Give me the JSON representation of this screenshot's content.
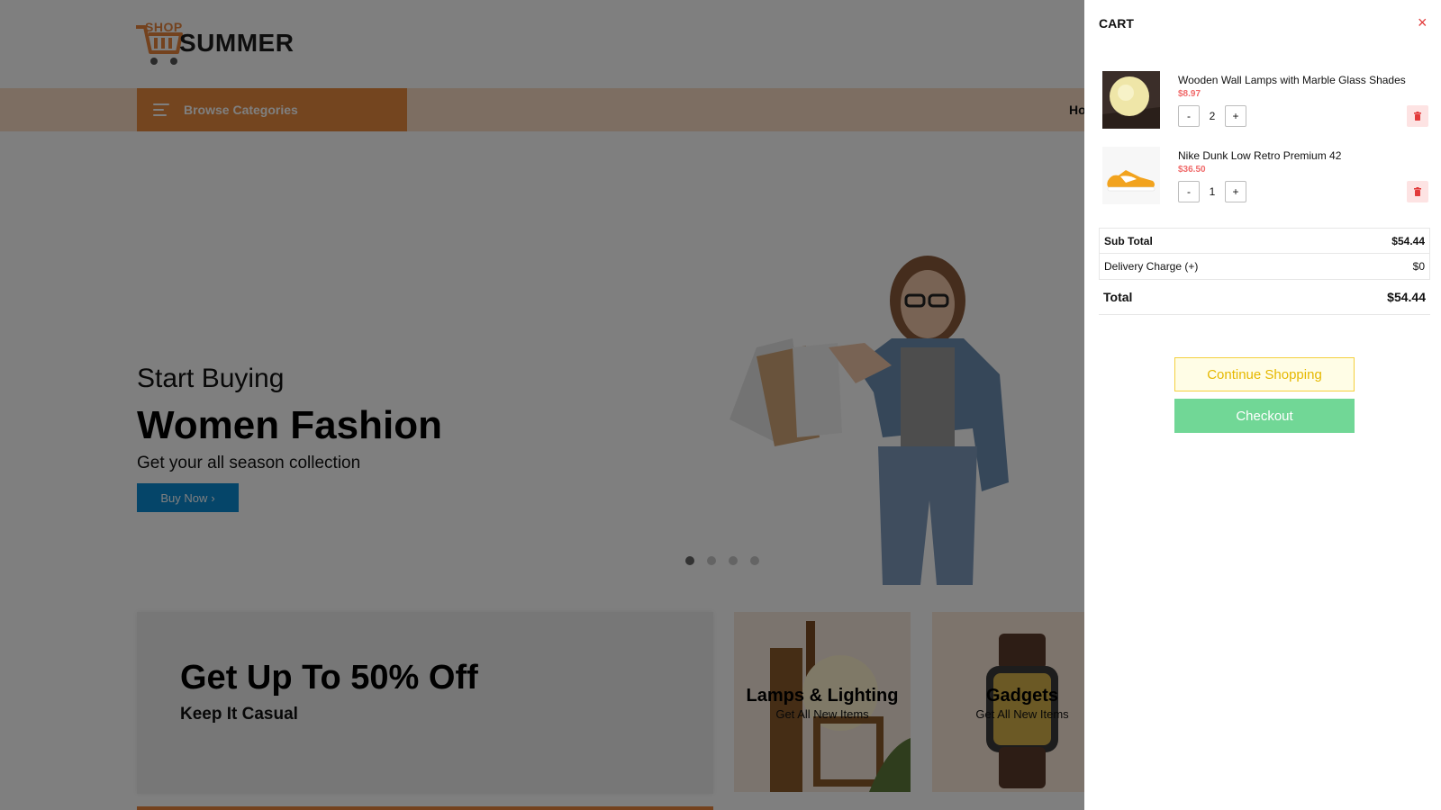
{
  "header": {
    "logo_small": "SHOP",
    "logo_main": "SUMMER"
  },
  "navbar": {
    "browse_label": "Browse Categories",
    "home_partial": "Ho"
  },
  "hero": {
    "subtitle": "Start Buying",
    "title": "Women Fashion",
    "description": "Get your all season collection",
    "button_label": "Buy Now",
    "slide_count": 4,
    "active_slide": 1
  },
  "promo": {
    "title": "Get Up To 50% Off",
    "subtitle": "Keep It Casual"
  },
  "categories": [
    {
      "title": "Lamps & Lighting",
      "subtitle": "Get All New Items"
    },
    {
      "title": "Gadgets",
      "subtitle": "Get All New Items"
    }
  ],
  "cart": {
    "title": "CART",
    "close_symbol": "×",
    "items": [
      {
        "name": "Wooden Wall Lamps with Marble Glass Shades",
        "price": "$8.97",
        "quantity": "2",
        "image": "lamp-image"
      },
      {
        "name": "Nike Dunk Low Retro Premium 42",
        "price": "$36.50",
        "quantity": "1",
        "image": "sneaker-image"
      }
    ],
    "qty_minus": "-",
    "qty_plus": "+",
    "sub_total_label": "Sub Total",
    "sub_total_value": "$54.44",
    "delivery_label": "Delivery Charge (+)",
    "delivery_value": "$0",
    "total_label": "Total",
    "total_value": "$54.44",
    "continue_label": "Continue Shopping",
    "checkout_label": "Checkout"
  },
  "colors": {
    "brand_orange": "#e98a3e",
    "buy_now_blue": "#0b8ad3",
    "price_red": "#f06a6a",
    "checkout_green": "#71d796",
    "continue_yellow": "#f4d03f"
  }
}
